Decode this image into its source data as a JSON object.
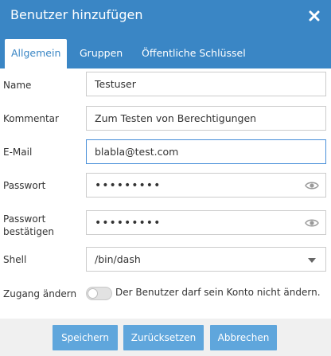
{
  "dialog": {
    "title": "Benutzer hinzufügen"
  },
  "tabs": [
    {
      "label": "Allgemein",
      "active": true
    },
    {
      "label": "Gruppen",
      "active": false
    },
    {
      "label": "Öffentliche Schlüssel",
      "active": false
    }
  ],
  "form": {
    "name": {
      "label": "Name",
      "value": "Testuser"
    },
    "comment": {
      "label": "Kommentar",
      "value": "Zum Testen von Berechtigungen"
    },
    "email": {
      "label": "E-Mail",
      "value": "blabla@test.com"
    },
    "password": {
      "label": "Passwort",
      "value": "•••••••••"
    },
    "password_confirm": {
      "label_line1": "Passwort",
      "label_line2": "bestätigen",
      "value": "•••••••••"
    },
    "shell": {
      "label": "Shell",
      "value": "/bin/dash"
    },
    "access": {
      "label": "Zugang ändern",
      "toggle_on": false,
      "toggle_text": "Der Benutzer darf sein Konto nicht ändern."
    }
  },
  "buttons": {
    "save": "Speichern",
    "reset": "Zurücksetzen",
    "cancel": "Abbrechen"
  },
  "colors": {
    "header_bg": "#3a86c5",
    "button_bg": "#5fa6dc",
    "footer_bg": "#f0f0f0",
    "focus_border": "#4a90d9"
  },
  "icons": {
    "close": "close-icon",
    "show_password": "eye-icon",
    "dropdown": "chevron-down-icon"
  }
}
